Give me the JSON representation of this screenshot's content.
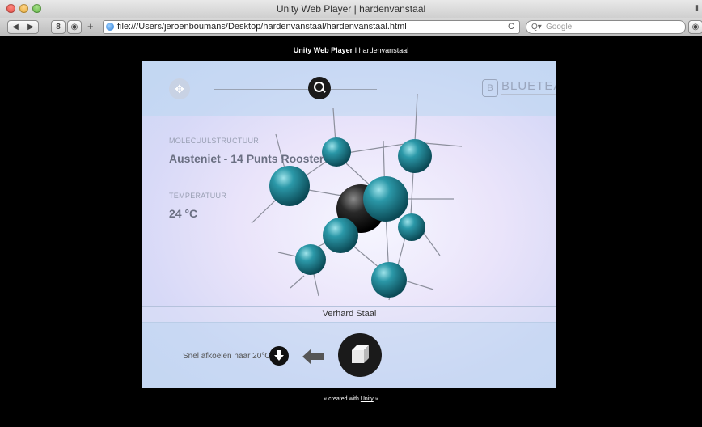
{
  "window": {
    "title": "Unity Web Player | hardenvanstaal"
  },
  "toolbar": {
    "url": "file:///Users/jeroenboumans/Desktop/hardenvanstaal/hardenvanstaal.html",
    "search_placeholder": "Google",
    "plus_label": "+",
    "bookmark_label": "8",
    "reload_label": "C"
  },
  "page": {
    "title_bold": "Unity Web Player",
    "title_rest": " I hardenvanstaal",
    "footer_prefix": "« created with ",
    "footer_link": "Unity",
    "footer_suffix": " »"
  },
  "game": {
    "brand": "BLUETEA",
    "brand_badge": "B",
    "structure_label": "MOLECUULSTRUCTUUR",
    "structure_value": "Austeniet - 14 Punts Rooster",
    "temperature_label": "TEMPERATUUR",
    "temperature_value": "24  °C",
    "state_label": "Verhard Staal",
    "cool_label": "Snel afkoelen naar 20°C"
  },
  "colors": {
    "atom_teal": "#1c8a9a",
    "atom_center": "#1a1a1a",
    "panel_blue": "#bcd6ef"
  }
}
